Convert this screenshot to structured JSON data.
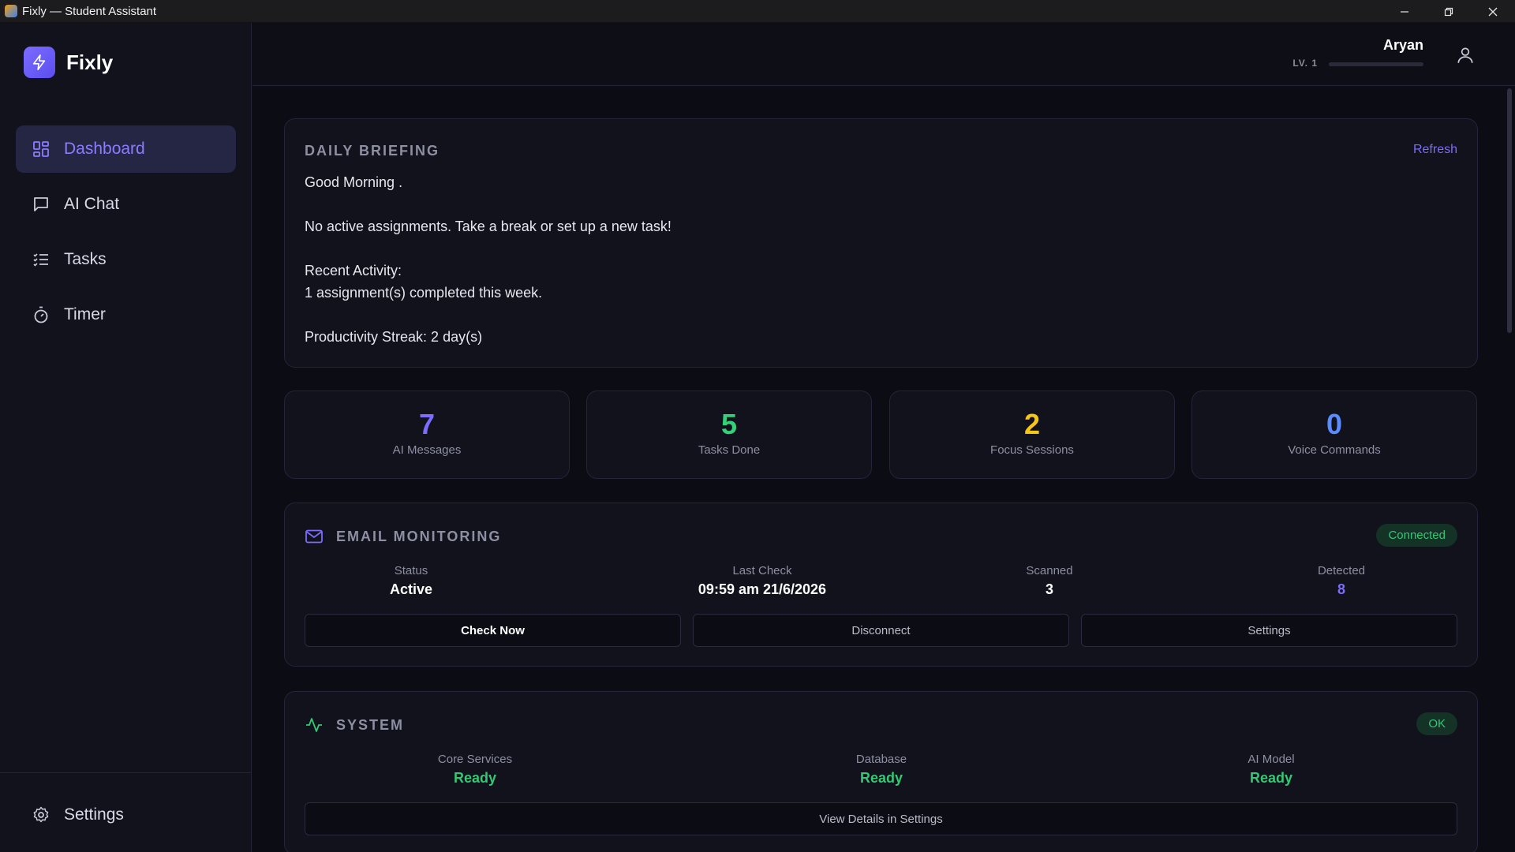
{
  "window": {
    "title": "Fixly — Student Assistant"
  },
  "brand": {
    "name": "Fixly"
  },
  "sidebar": {
    "items": [
      {
        "label": "Dashboard",
        "icon": "dashboard-grid-icon",
        "active": true
      },
      {
        "label": "AI Chat",
        "icon": "chat-bubble-icon"
      },
      {
        "label": "Tasks",
        "icon": "task-list-icon"
      },
      {
        "label": "Timer",
        "icon": "stopwatch-icon"
      }
    ],
    "settings_label": "Settings"
  },
  "header": {
    "username": "Aryan",
    "level_label": "LV. 1",
    "level_progress": 0
  },
  "briefing": {
    "title": "DAILY BRIEFING",
    "refresh_label": "Refresh",
    "body": "Good Morning .\n\nNo active assignments. Take a break or set up a new task!\n\nRecent Activity:\n  1 assignment(s) completed this week.\n\nProductivity Streak: 2 day(s)"
  },
  "stats": [
    {
      "value": "7",
      "label": "AI Messages",
      "color": "#7c6cff"
    },
    {
      "value": "5",
      "label": "Tasks Done",
      "color": "#34d17a"
    },
    {
      "value": "2",
      "label": "Focus Sessions",
      "color": "#f5c518"
    },
    {
      "value": "0",
      "label": "Voice Commands",
      "color": "#5b8cff"
    }
  ],
  "email": {
    "title": "EMAIL MONITORING",
    "badge": "Connected",
    "metrics": [
      {
        "label": "Status",
        "value": "Active"
      },
      {
        "label": "Last Check",
        "value": "09:59 am 21/6/2026"
      },
      {
        "label": "Scanned",
        "value": "3"
      },
      {
        "label": "Detected",
        "value": "8"
      }
    ],
    "buttons": {
      "check_now": "Check Now",
      "disconnect": "Disconnect",
      "settings": "Settings"
    }
  },
  "system": {
    "title": "SYSTEM",
    "badge": "OK",
    "metrics": [
      {
        "label": "Core Services",
        "value": "Ready"
      },
      {
        "label": "Database",
        "value": "Ready"
      },
      {
        "label": "AI Model",
        "value": "Ready"
      }
    ],
    "details_button": "View Details in Settings"
  },
  "colors": {
    "accent": "#7c6cff",
    "success": "#34c774",
    "background": "#0c0d14"
  }
}
